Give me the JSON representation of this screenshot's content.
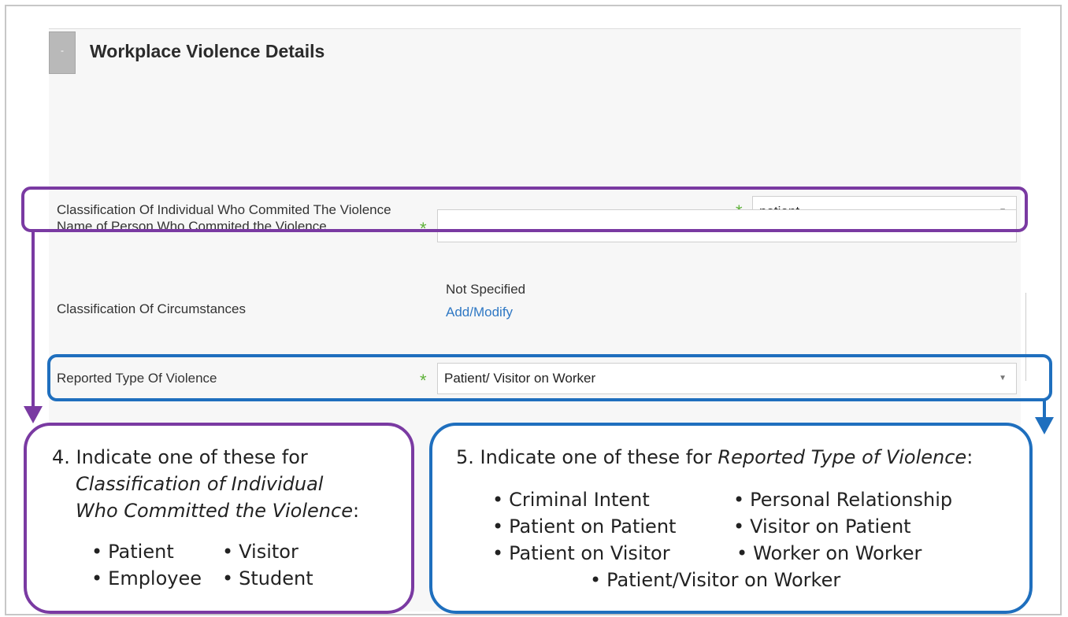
{
  "section": {
    "title": "Workplace Violence Details",
    "collapse_symbol": "-"
  },
  "fields": {
    "classification_individual": {
      "label": "Classification Of Individual Who Commited The Violence",
      "value": "patient",
      "required_mark": "*"
    },
    "name_person": {
      "label": "Name of Person Who Commited the Violence",
      "value": "",
      "required_mark": "*"
    },
    "classification_circumstances": {
      "label": "Classification Of Circumstances",
      "value_text": "Not Specified",
      "link": "Add/Modify"
    },
    "reported_type": {
      "label": "Reported Type Of Violence",
      "value": "Patient/ Visitor on Worker",
      "required_mark": "*"
    }
  },
  "callout4": {
    "line1": "4. Indicate one of these for",
    "line2": "Classification of Individual",
    "line3": "Who Committed the Violence",
    "line3_suffix": ":",
    "options": [
      "Patient",
      "Visitor",
      "Employee",
      "Student"
    ]
  },
  "callout5": {
    "lead": "5. Indicate one of these for ",
    "italic": "Reported Type of Violence",
    "suffix": ":",
    "options": [
      "Criminal Intent",
      "Personal Relationship",
      "Patient on Patient",
      "Visitor on Patient",
      "Patient on Visitor",
      "Worker on Worker",
      "Patient/Visitor on Worker"
    ]
  },
  "colors": {
    "purple": "#7a3aa2",
    "blue": "#1f6fbe",
    "required_green": "#5fb23a",
    "link_blue": "#2f78c4"
  },
  "icons": {
    "collapse": "collapse-icon",
    "dropdown": "chevron-down-icon"
  }
}
